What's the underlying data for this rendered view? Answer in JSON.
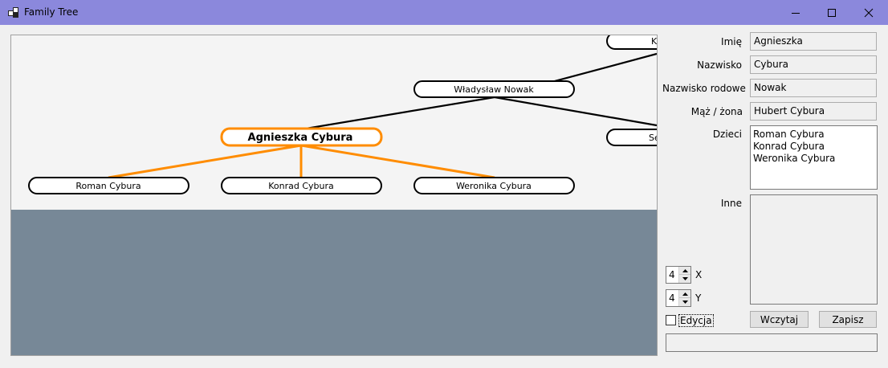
{
  "window": {
    "title": "Family Tree",
    "app_icon": "family-tree-app-icon",
    "controls": [
      "minimize-icon",
      "maximize-icon",
      "close-icon"
    ]
  },
  "tree": {
    "background_color": "#778897",
    "panel_color": "#f4f4f4",
    "selected_color": "#ff8c00",
    "nodes": [
      {
        "label": "Agnieszka Cybura",
        "selected": true
      },
      {
        "label": "Władysław Nowak",
        "selected": false
      },
      {
        "label": "Roman Cybura",
        "selected": false
      },
      {
        "label": "Konrad Cybura",
        "selected": false
      },
      {
        "label": "Weronika Cybura",
        "selected": false
      },
      {
        "label": "K",
        "selected": false
      },
      {
        "label": "Se",
        "selected": false
      }
    ]
  },
  "form": {
    "first_name_label": "Imię",
    "first_name": "Agnieszka",
    "last_name_label": "Nazwisko",
    "last_name": "Cybura",
    "maiden_name_label": "Nazwisko rodowe",
    "maiden_name": "Nowak",
    "spouse_label": "Mąż / żona",
    "spouse": "Hubert Cybura",
    "children_label": "Dzieci",
    "children": [
      "Roman Cybura",
      "Konrad Cybura",
      "Weronika Cybura"
    ],
    "other_label": "Inne",
    "other": ""
  },
  "controls": {
    "x_value": "4",
    "x_label": "X",
    "y_value": "4",
    "y_label": "Y",
    "edit_label": "Edycja",
    "edit_checked": false,
    "load_label": "Wczytaj",
    "save_label": "Zapisz",
    "status_text": ""
  }
}
